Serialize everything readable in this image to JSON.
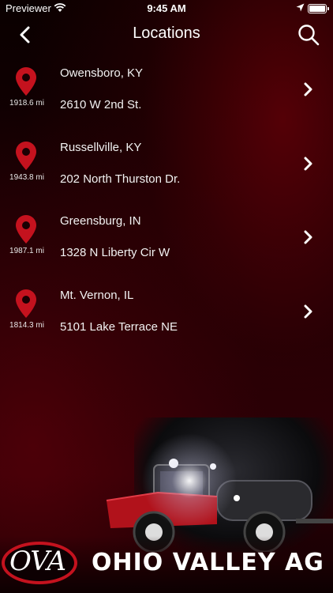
{
  "status": {
    "carrier": "Previewer",
    "time": "9:45 AM"
  },
  "nav": {
    "title": "Locations"
  },
  "locations": [
    {
      "distance": "1918.6 mi",
      "city": "Owensboro, KY",
      "address": "2610 W 2nd St."
    },
    {
      "distance": "1943.8 mi",
      "city": "Russellville, KY",
      "address": "202 North Thurston Dr."
    },
    {
      "distance": "1987.1 mi",
      "city": "Greensburg, IN",
      "address": "1328 N Liberty Cir W"
    },
    {
      "distance": "1814.3 mi",
      "city": "Mt. Vernon, IL",
      "address": "5101 Lake Terrace NE"
    }
  ],
  "banner": {
    "logo": "OVA",
    "name": "OHIO VALLEY AG"
  },
  "colors": {
    "accent": "#c4121e",
    "background": "#000000"
  },
  "icons": [
    "back-chevron-icon",
    "search-icon",
    "map-pin-icon",
    "chevron-right-icon",
    "wifi-icon",
    "location-arrow-icon",
    "battery-icon"
  ]
}
